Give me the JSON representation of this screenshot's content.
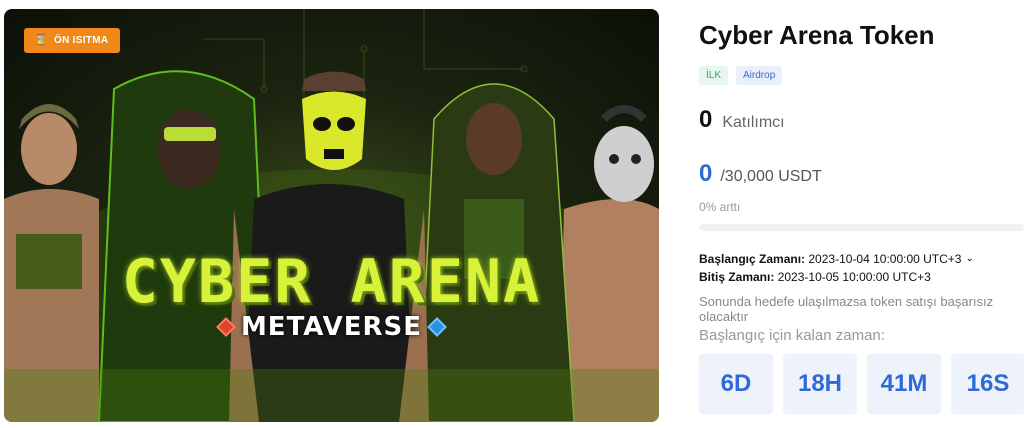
{
  "banner": {
    "phase_badge": "ÖN ISITMA",
    "title_art": "CYBER ARENA",
    "subtitle_art": "METAVERSE"
  },
  "token": {
    "title": "Cyber Arena Token",
    "tags": [
      "İLK",
      "Airdrop"
    ]
  },
  "stats": {
    "participants_value": "0",
    "participants_label": "Katılımcı",
    "raised_value": "0",
    "raised_target": "/30,000 USDT",
    "progress_text": "0% arttı",
    "progress_fraction": 0
  },
  "schedule": {
    "start_label": "Başlangıç Zamanı:",
    "start_value": "2023-10-04 10:00:00 UTC+3",
    "end_label": "Bitiş Zamanı:",
    "end_value": "2023-10-05 10:00:00 UTC+3",
    "note": "Sonunda hedefe ulaşılmazsa token satışı başarısız olacaktır",
    "remaining_label": "Başlangıç için kalan zaman:"
  },
  "countdown": {
    "days": "6D",
    "hours": "18H",
    "minutes": "41M",
    "seconds": "16S"
  },
  "colors": {
    "accent": "#2f6ad8",
    "badge": "#f0891a",
    "title_art": "#d8f23a"
  }
}
